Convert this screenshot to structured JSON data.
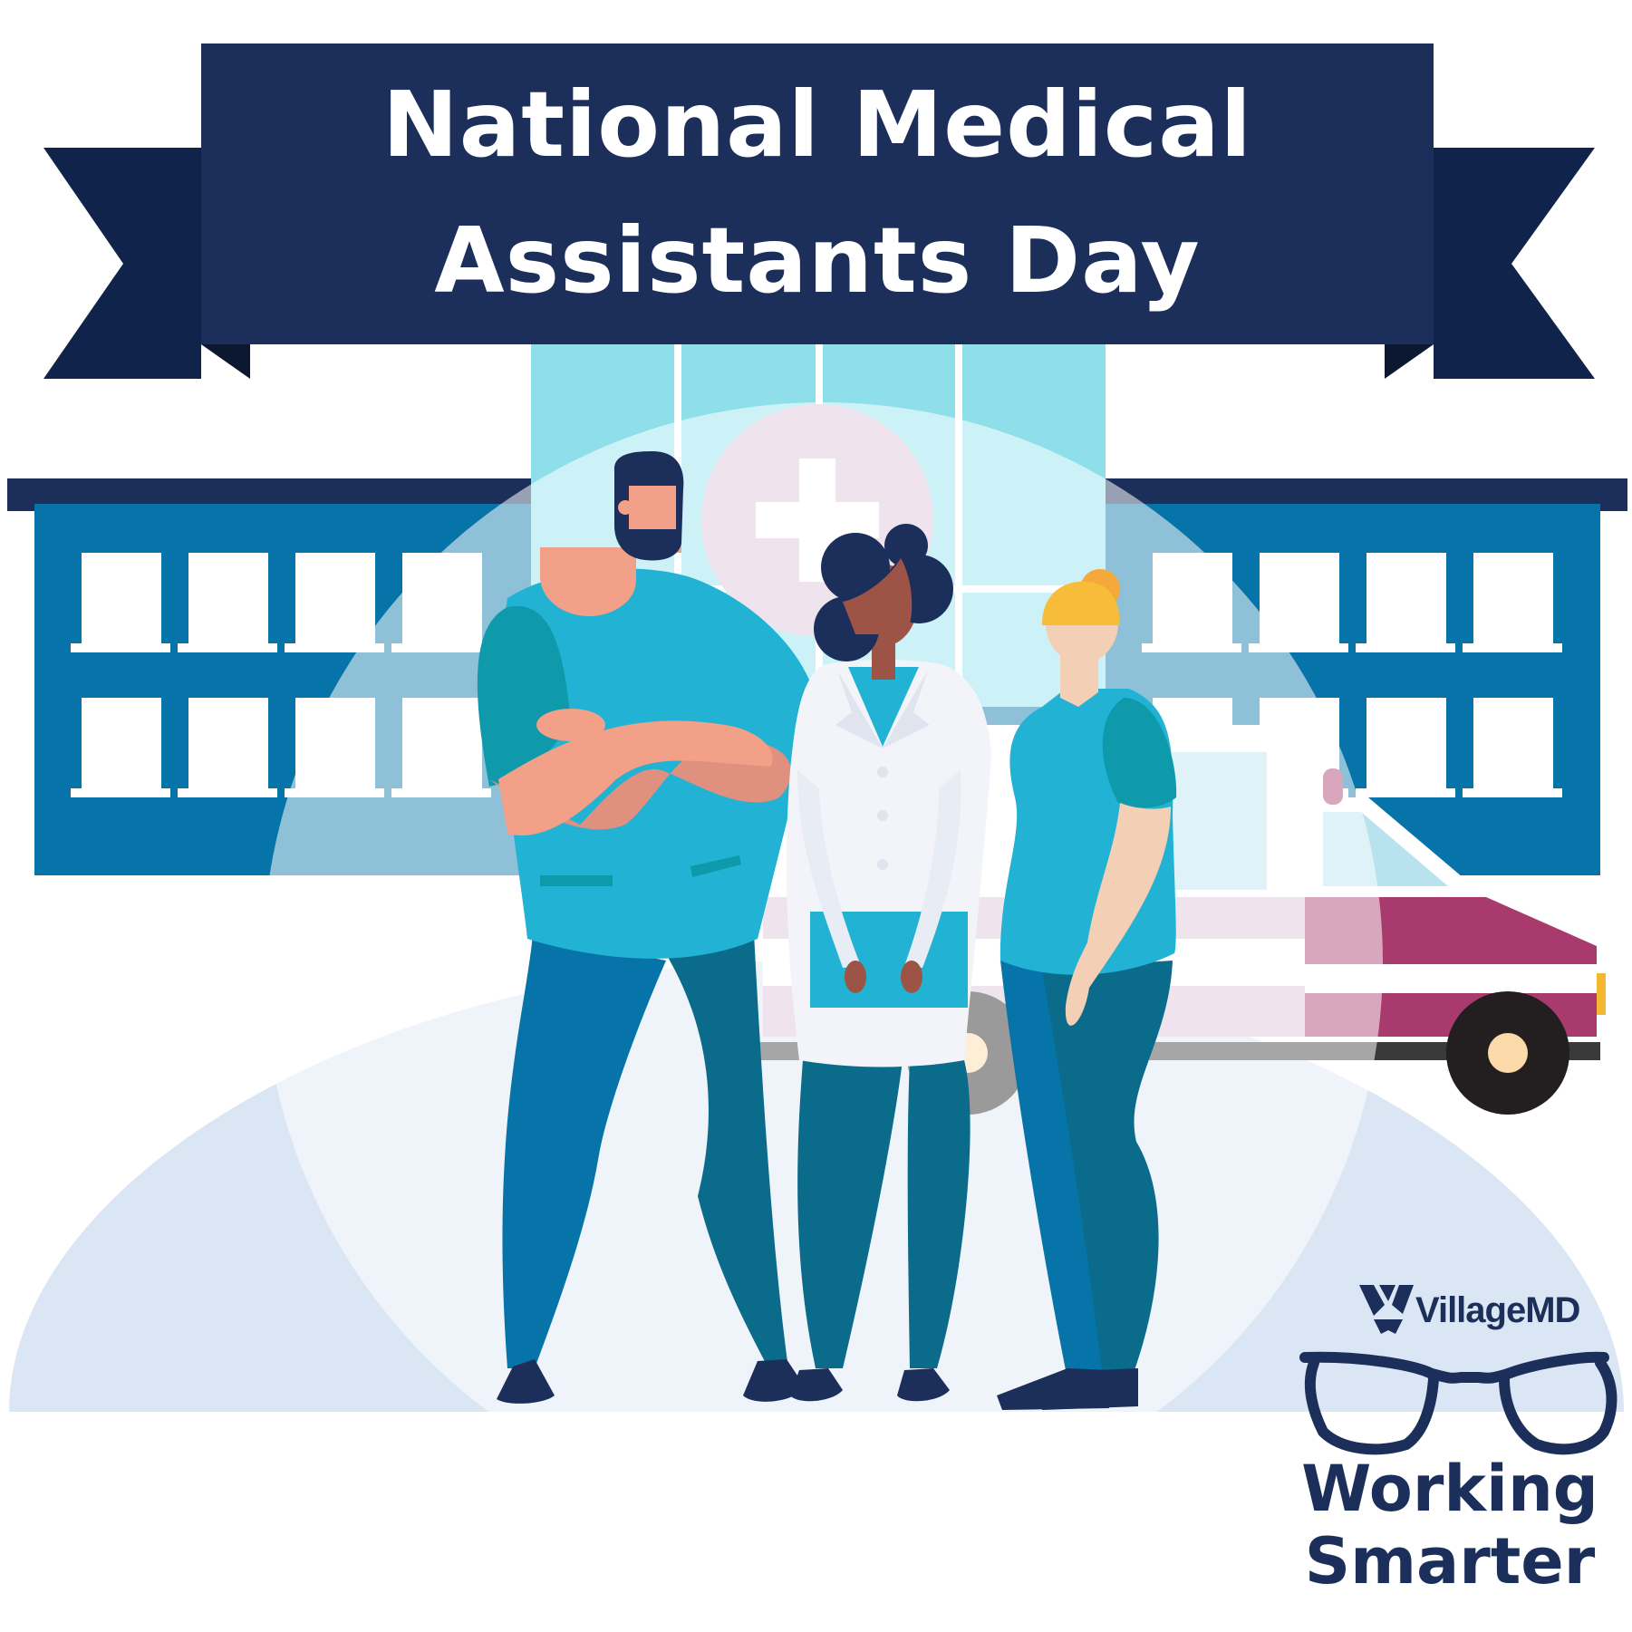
{
  "banner": {
    "title_line_1": "National Medical",
    "title_line_2": "Assistants Day"
  },
  "brand": {
    "name": "VillageMD",
    "tagline_line_1": "Working",
    "tagline_line_2": "Smarter"
  },
  "icons": [
    "village-md-logo-icon",
    "glasses-icon",
    "medical-cross-icon",
    "ambulance-icon",
    "hospital-building-icon"
  ],
  "colors": {
    "navy": "#1c2f5a",
    "hospital_blue": "#0674a8",
    "scrubs_cyan": "#22b3d4",
    "scrubs_teal": "#0e9aab",
    "pants_blue": "#0b6b8b",
    "ambulance_magenta": "#a83a6e",
    "window_aqua": "#8fdfea"
  }
}
